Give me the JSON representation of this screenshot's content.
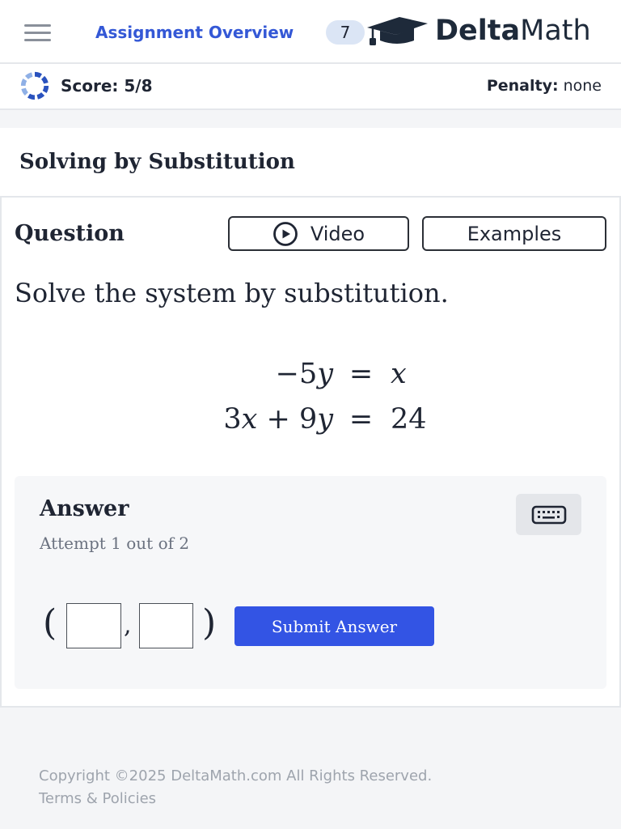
{
  "header": {
    "menu_icon": "hamburger-menu-icon",
    "assignment_link": "Assignment Overview",
    "badge_count": "7",
    "logo_icon": "graduation-cap-icon",
    "logo_text_bold": "Delta",
    "logo_text_regular": "Math"
  },
  "score_bar": {
    "progress_icon": "score-progress-ring-icon",
    "score_label": "Score: 5/8",
    "penalty_label": "Penalty:",
    "penalty_value": "none"
  },
  "section": {
    "title": "Solving by Substitution"
  },
  "question": {
    "heading": "Question",
    "video_icon": "play-circle-icon",
    "video_button": "Video",
    "examples_button": "Examples",
    "prompt": "Solve the system by substitution.",
    "equals_sign": "=",
    "equations": [
      {
        "lhs": "−5y",
        "rhs": "x"
      },
      {
        "lhs": "3x + 9y",
        "rhs": "24"
      }
    ]
  },
  "answer": {
    "heading": "Answer",
    "attempt_text": "Attempt 1 out of 2",
    "keyboard_icon": "keyboard-icon",
    "open_paren": "(",
    "separator": ",",
    "close_paren": ")",
    "inputs": [
      {
        "value": ""
      },
      {
        "value": ""
      }
    ],
    "submit_button": "Submit Answer"
  },
  "footer": {
    "copyright": "Copyright ©2025 DeltaMath.com All Rights Reserved.",
    "terms_link": "Terms & Policies"
  },
  "colors": {
    "link_blue": "#3458d6",
    "submit_blue": "#3354e4",
    "score_ring_blue": "#2a52be",
    "badge_bg": "#dbe5f5",
    "panel_bg": "#f6f7f9",
    "page_bg": "#f4f5f7",
    "footer_text": "#9ea4ad"
  }
}
